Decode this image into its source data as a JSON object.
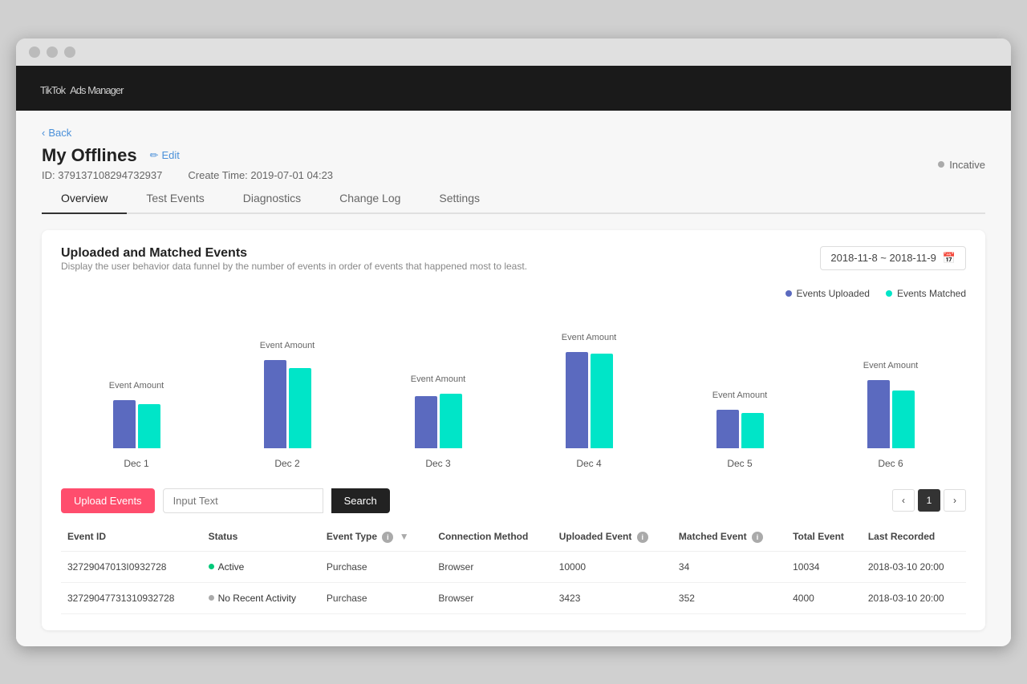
{
  "window": {
    "title": "TikTok Ads Manager"
  },
  "topbar": {
    "brand": "TikTok",
    "product": "Ads Manager"
  },
  "back_label": "Back",
  "page": {
    "title": "My Offlines",
    "edit_label": "Edit",
    "id_label": "ID: 379137108294732937",
    "create_time_label": "Create Time: 2019-07-01 04:23",
    "status": "Incative"
  },
  "tabs": [
    "Overview",
    "Test Events",
    "Diagnostics",
    "Change Log",
    "Settings"
  ],
  "chart_section": {
    "title": "Uploaded and Matched Events",
    "subtitle": "Display the user behavior data funnel by the number of events in order of events that happened most to least.",
    "date_range": "2018-11-8 ~ 2018-11-9",
    "legend": {
      "uploaded_label": "Events Uploaded",
      "matched_label": "Events Matched"
    },
    "event_amount_label": "Event Amount",
    "bars": [
      {
        "date": "Dec 1",
        "uploaded": 60,
        "matched": 55
      },
      {
        "date": "Dec 2",
        "uploaded": 110,
        "matched": 100
      },
      {
        "date": "Dec 3",
        "uploaded": 65,
        "matched": 68
      },
      {
        "date": "Dec 4",
        "uploaded": 120,
        "matched": 118
      },
      {
        "date": "Dec 5",
        "uploaded": 48,
        "matched": 44
      },
      {
        "date": "Dec 6",
        "uploaded": 85,
        "matched": 72
      }
    ]
  },
  "toolbar": {
    "upload_btn": "Upload Events",
    "search_placeholder": "Input Text",
    "search_btn": "Search",
    "page_number": "1"
  },
  "table": {
    "columns": [
      "Event ID",
      "Status",
      "Event Type",
      "Connection Method",
      "Uploaded Event",
      "Matched Event",
      "Total Event",
      "Last Recorded"
    ],
    "rows": [
      {
        "event_id": "32729047013I0932728",
        "status": "Active",
        "status_type": "active",
        "event_type": "Purchase",
        "connection_method": "Browser",
        "uploaded_event": "10000",
        "matched_event": "34",
        "total_event": "10034",
        "last_recorded": "2018-03-10 20:00"
      },
      {
        "event_id": "32729047731310932728",
        "status": "No Recent Activity",
        "status_type": "inactive",
        "event_type": "Purchase",
        "connection_method": "Browser",
        "uploaded_event": "3423",
        "matched_event": "352",
        "total_event": "4000",
        "last_recorded": "2018-03-10 20:00"
      }
    ]
  }
}
